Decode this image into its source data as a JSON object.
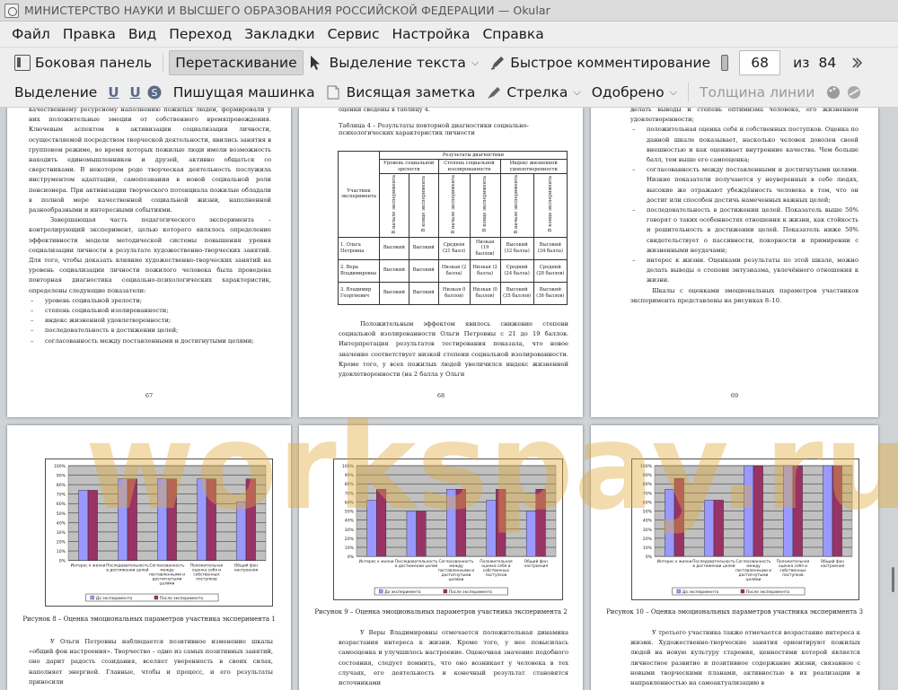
{
  "window": {
    "title": "МИНИСТЕРСТВО НАУКИ И ВЫСШЕГО ОБРАЗОВАНИЯ РОССИЙСКОЙ ФЕДЕРАЦИИ  — Okular"
  },
  "menu": [
    "Файл",
    "Правка",
    "Вид",
    "Переход",
    "Закладки",
    "Сервис",
    "Настройка",
    "Справка"
  ],
  "toolbar1": {
    "sidebar": "Боковая панель",
    "drag": "Перетаскивание",
    "text_select": "Выделение текста",
    "quick_comment": "Быстрое комментирование",
    "page_current": "68",
    "page_of": "из",
    "page_total": "84"
  },
  "toolbar2": {
    "selection": "Выделение",
    "typewriter": "Пишущая машинка",
    "note": "Висящая заметка",
    "arrow": "Стрелка",
    "approved": "Одобрено",
    "line_width": "Толщина линии"
  },
  "watermark": "workspay.ru",
  "page67": {
    "paragraphs": [
      "качественному ресурсному наполнению пожилых людей, формировали у них положительные эмоции от собственного времяпровождения. Ключевым аспектом в активизации социализации личности, осуществляемой посредством творческой деятельности, явились занятия в групповом режиме, во время которых пожилые люди имели возможность находить единомышленников и друзей, активно общаться со сверстниками. В некотором роде творческая деятельность послужила инструментом адаптации, самопознания в новой социальной роли пенсионера. При активизации творческого потенциала пожилые обладали в полной мере качественной социальной жизни, наполненной разнообразными и интересными событиями.",
      "Завершающая часть педагогического эксперимента – контролирующий эксперимент, целью которого являлось определение эффективности модели методической системы повышения уровня социализации личности в результате художественно-творческих занятий. Для того, чтобы доказать влияние художественно-творческих занятий на уровень социализации личности пожилого человека была проведена повторная диагностика социально-психологических характеристик, определены следующие показатели:"
    ],
    "list": [
      "уровень социальной зрелости;",
      "степень социальной изолированности;",
      "индекс жизненной удовлетворенности;",
      "последовательность в достижении целей;",
      "согласованность между поставленными и достигнутыми целями;"
    ],
    "page_number": "67"
  },
  "page68": {
    "top_text": "оценки сведены в таблицу 4.",
    "table_title": "Таблица 4 – Результаты повторной диагностики социально-психологических характеристик личности",
    "table": {
      "header_top": "Результаты диагностики",
      "col_participant": "Участник эксперимента",
      "groups": [
        "Уровень социальной зрелости",
        "Степень социальной изолированности",
        "Индекс жизненной удовлетворенности"
      ],
      "sub": [
        "В начале эксперимента",
        "В конце эксперимента"
      ],
      "rows": [
        {
          "name": "1. Ольга Петровна",
          "cells": [
            "Высокий",
            "Высокий",
            "Средняя (21 балл)",
            "Низкая (19 баллов)",
            "Высокий (32 балла)",
            "Высокий (34 балла)"
          ]
        },
        {
          "name": "2. Вера Владимировна",
          "cells": [
            "Высокий",
            "Высокий",
            "Низкая (2 балла)",
            "Низкая (2 балла)",
            "Средний (24 балла)",
            "Средний (28 баллов)"
          ]
        },
        {
          "name": "3. Владимир Георгиевич",
          "cells": [
            "Высокий",
            "Высокий",
            "Низкая 0 баллов)",
            "Низкая (0 баллов)",
            "Высокий (35 баллов)",
            "Высокий (36 баллов)"
          ]
        }
      ]
    },
    "paragraph": "Положительным эффектом явилось снижение степени социальной изолированности Ольги Петровны с 21 до 19 баллов. Интерпретация результатов тестирования показала, что новое значение соответствует низкой степени социальной изолированности. Кроме того, у всех пожилых людей увеличился индекс жизненной удовлетворенности (на 2 балла у Ольги",
    "page_number": "68"
  },
  "page69": {
    "items": [
      "делать выводы и степень оптимизма человека, его жизненной удовлетворенности;",
      "положительная оценка себя и собственных поступков. Оценка по данной шкале показывает, насколько человек доволен своей внешностью и как оценивает внутренние качества. Чем больше балл, тем выше его самооценка;",
      "согласованность между поставленными и достигнутыми целями. Низкие показатели получаются у неуверенных в себе людях, высокие же отражают убеждённость человека в том, что он достиг или способен достичь намеченных важных целей;",
      "последовательность в достижении целей. Показатель выше 50% говорят о таких особенностях отношения к жизни, как стойкость и решительность в достижении целей. Показатель ниже 50% свидетельствует о пассивности, покорности и примирении с жизненными неудачами;",
      "интерес к жизни. Оценками результаты по этой шкале, можно делать выводы о степени энтузиазма, увлечённого отношения к жизни."
    ],
    "paragraph": "Шкалы с оценками эмоциональных параметров участников эксперимента представлены на рисунках 8–10.",
    "page_number": "69"
  },
  "page70": {
    "caption": "Рисунок 8 – Оценка эмоциональных параметров участника эксперимента 1",
    "paragraph": "У Ольги Петровны наблюдается позитивное изменение шкалы «общий фон настроения». Творчество – одно из самых позитивных занятий, оно дарит радость созидания, вселяет уверенность в своих силах, наполняет энергией. Главные, чтобы и процесс, и его результаты приносили"
  },
  "page71": {
    "caption": "Рисунок 9 – Оценка эмоциональных параметров участника эксперимента 2",
    "paragraph": "У Веры Владимировны отмечается положительная динамика возрастания интереса к жизни. Кроме того, у нее повысилась самооценка и улучшилось настроение. Оценочная значение подобного состояния, следует помнить, что оно возникает у человека в тех случаях, его деятельность и конечный результат становятся источниками"
  },
  "page72": {
    "caption": "Рисунок 10 – Оценка эмоциональных параметров участника эксперимента 3",
    "paragraph": "У третьего участника также отмечается возрастание интереса к жизни. Художественно-творческие занятия ориентируют пожилых людей на новую культуру старения, ценностями которой является личностное развитие и позитивное содержание жизни, связанное с новыми творческими планами, активностью в их реализации и направленностью на самоактуализацию в"
  },
  "chart_data": [
    {
      "type": "bar",
      "categories": [
        "Интерес к жизни",
        "Последовательность в достижении целей",
        "Согласованность между поставленными и достигнутыми целями",
        "Положительная оценка себя и собственных поступков",
        "Общий фон настроения"
      ],
      "series": [
        {
          "name": "До эксперимента",
          "values": [
            74,
            86,
            86,
            86,
            62
          ]
        },
        {
          "name": "После эксперимента",
          "values": [
            74,
            86,
            86,
            86,
            86
          ]
        }
      ],
      "yticks": [
        "0%",
        "10%",
        "20%",
        "30%",
        "40%",
        "50%",
        "60%",
        "70%",
        "80%",
        "90%",
        "100%"
      ],
      "ylim": [
        0,
        100
      ],
      "colors": [
        "#9999ff",
        "#993366"
      ],
      "grid": true,
      "legend": "bottom"
    },
    {
      "type": "bar",
      "categories": [
        "Интерес к жизни",
        "Последовательность в достижении целей",
        "Согласованность между поставленными и достигнутыми целями",
        "Положительная оценка себя и собственных поступков",
        "Общий фон настроения"
      ],
      "series": [
        {
          "name": "До эксперимента",
          "values": [
            62,
            50,
            74,
            62,
            50
          ]
        },
        {
          "name": "После эксперимента",
          "values": [
            74,
            50,
            74,
            74,
            74
          ]
        }
      ],
      "yticks": [
        "0%",
        "10%",
        "20%",
        "30%",
        "40%",
        "50%",
        "60%",
        "70%",
        "80%",
        "90%",
        "100%"
      ],
      "ylim": [
        0,
        100
      ],
      "colors": [
        "#9999ff",
        "#993366"
      ],
      "grid": true,
      "legend": "bottom"
    },
    {
      "type": "bar",
      "categories": [
        "Интерес к жизни",
        "Последовательность в достижении целей",
        "Согласованность между поставленными и достигнутыми целями",
        "Положительная оценка себя и собственных поступков",
        "Общий фон настроения"
      ],
      "series": [
        {
          "name": "До эксперимента",
          "values": [
            74,
            62,
            100,
            100,
            100
          ]
        },
        {
          "name": "После эксперимента",
          "values": [
            86,
            62,
            100,
            100,
            100
          ]
        }
      ],
      "yticks": [
        "0%",
        "10%",
        "20%",
        "30%",
        "40%",
        "50%",
        "60%",
        "70%",
        "80%",
        "90%",
        "100%"
      ],
      "ylim": [
        0,
        100
      ],
      "colors": [
        "#9999ff",
        "#993366"
      ],
      "grid": true,
      "legend": "bottom"
    }
  ]
}
